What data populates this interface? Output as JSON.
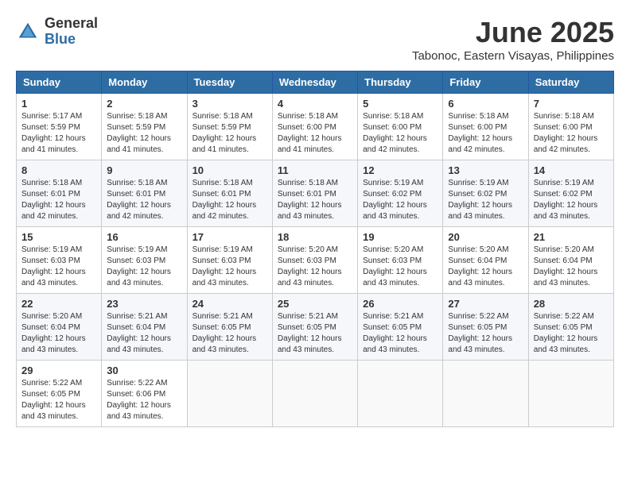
{
  "logo": {
    "general": "General",
    "blue": "Blue"
  },
  "title": "June 2025",
  "subtitle": "Tabonoc, Eastern Visayas, Philippines",
  "headers": [
    "Sunday",
    "Monday",
    "Tuesday",
    "Wednesday",
    "Thursday",
    "Friday",
    "Saturday"
  ],
  "weeks": [
    [
      {
        "day": "1",
        "sunrise": "5:17 AM",
        "sunset": "5:59 PM",
        "daylight": "12 hours and 41 minutes."
      },
      {
        "day": "2",
        "sunrise": "5:18 AM",
        "sunset": "5:59 PM",
        "daylight": "12 hours and 41 minutes."
      },
      {
        "day": "3",
        "sunrise": "5:18 AM",
        "sunset": "5:59 PM",
        "daylight": "12 hours and 41 minutes."
      },
      {
        "day": "4",
        "sunrise": "5:18 AM",
        "sunset": "6:00 PM",
        "daylight": "12 hours and 41 minutes."
      },
      {
        "day": "5",
        "sunrise": "5:18 AM",
        "sunset": "6:00 PM",
        "daylight": "12 hours and 42 minutes."
      },
      {
        "day": "6",
        "sunrise": "5:18 AM",
        "sunset": "6:00 PM",
        "daylight": "12 hours and 42 minutes."
      },
      {
        "day": "7",
        "sunrise": "5:18 AM",
        "sunset": "6:00 PM",
        "daylight": "12 hours and 42 minutes."
      }
    ],
    [
      {
        "day": "8",
        "sunrise": "5:18 AM",
        "sunset": "6:01 PM",
        "daylight": "12 hours and 42 minutes."
      },
      {
        "day": "9",
        "sunrise": "5:18 AM",
        "sunset": "6:01 PM",
        "daylight": "12 hours and 42 minutes."
      },
      {
        "day": "10",
        "sunrise": "5:18 AM",
        "sunset": "6:01 PM",
        "daylight": "12 hours and 42 minutes."
      },
      {
        "day": "11",
        "sunrise": "5:18 AM",
        "sunset": "6:01 PM",
        "daylight": "12 hours and 43 minutes."
      },
      {
        "day": "12",
        "sunrise": "5:19 AM",
        "sunset": "6:02 PM",
        "daylight": "12 hours and 43 minutes."
      },
      {
        "day": "13",
        "sunrise": "5:19 AM",
        "sunset": "6:02 PM",
        "daylight": "12 hours and 43 minutes."
      },
      {
        "day": "14",
        "sunrise": "5:19 AM",
        "sunset": "6:02 PM",
        "daylight": "12 hours and 43 minutes."
      }
    ],
    [
      {
        "day": "15",
        "sunrise": "5:19 AM",
        "sunset": "6:03 PM",
        "daylight": "12 hours and 43 minutes."
      },
      {
        "day": "16",
        "sunrise": "5:19 AM",
        "sunset": "6:03 PM",
        "daylight": "12 hours and 43 minutes."
      },
      {
        "day": "17",
        "sunrise": "5:19 AM",
        "sunset": "6:03 PM",
        "daylight": "12 hours and 43 minutes."
      },
      {
        "day": "18",
        "sunrise": "5:20 AM",
        "sunset": "6:03 PM",
        "daylight": "12 hours and 43 minutes."
      },
      {
        "day": "19",
        "sunrise": "5:20 AM",
        "sunset": "6:03 PM",
        "daylight": "12 hours and 43 minutes."
      },
      {
        "day": "20",
        "sunrise": "5:20 AM",
        "sunset": "6:04 PM",
        "daylight": "12 hours and 43 minutes."
      },
      {
        "day": "21",
        "sunrise": "5:20 AM",
        "sunset": "6:04 PM",
        "daylight": "12 hours and 43 minutes."
      }
    ],
    [
      {
        "day": "22",
        "sunrise": "5:20 AM",
        "sunset": "6:04 PM",
        "daylight": "12 hours and 43 minutes."
      },
      {
        "day": "23",
        "sunrise": "5:21 AM",
        "sunset": "6:04 PM",
        "daylight": "12 hours and 43 minutes."
      },
      {
        "day": "24",
        "sunrise": "5:21 AM",
        "sunset": "6:05 PM",
        "daylight": "12 hours and 43 minutes."
      },
      {
        "day": "25",
        "sunrise": "5:21 AM",
        "sunset": "6:05 PM",
        "daylight": "12 hours and 43 minutes."
      },
      {
        "day": "26",
        "sunrise": "5:21 AM",
        "sunset": "6:05 PM",
        "daylight": "12 hours and 43 minutes."
      },
      {
        "day": "27",
        "sunrise": "5:22 AM",
        "sunset": "6:05 PM",
        "daylight": "12 hours and 43 minutes."
      },
      {
        "day": "28",
        "sunrise": "5:22 AM",
        "sunset": "6:05 PM",
        "daylight": "12 hours and 43 minutes."
      }
    ],
    [
      {
        "day": "29",
        "sunrise": "5:22 AM",
        "sunset": "6:05 PM",
        "daylight": "12 hours and 43 minutes."
      },
      {
        "day": "30",
        "sunrise": "5:22 AM",
        "sunset": "6:06 PM",
        "daylight": "12 hours and 43 minutes."
      },
      null,
      null,
      null,
      null,
      null
    ]
  ],
  "labels": {
    "sunrise": "Sunrise:",
    "sunset": "Sunset:",
    "daylight": "Daylight:"
  }
}
